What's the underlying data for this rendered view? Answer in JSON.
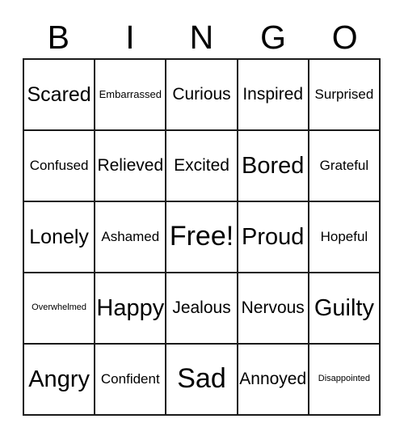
{
  "card": {
    "title": "BINGO",
    "header_letters": [
      "B",
      "I",
      "N",
      "G",
      "O"
    ],
    "border_color": "#1a1a1a",
    "text_color": "#000000",
    "background_color": "#ffffff",
    "rows": [
      [
        {
          "label": "Scared",
          "size": "t-lg"
        },
        {
          "label": "Embarrassed",
          "size": "t-xs"
        },
        {
          "label": "Curious",
          "size": "t-md"
        },
        {
          "label": "Inspired",
          "size": "t-md"
        },
        {
          "label": "Surprised",
          "size": "t-sm"
        }
      ],
      [
        {
          "label": "Confused",
          "size": "t-sm"
        },
        {
          "label": "Relieved",
          "size": "t-md"
        },
        {
          "label": "Excited",
          "size": "t-md"
        },
        {
          "label": "Bored",
          "size": "t-xl"
        },
        {
          "label": "Grateful",
          "size": "t-sm"
        }
      ],
      [
        {
          "label": "Lonely",
          "size": "t-lg"
        },
        {
          "label": "Ashamed",
          "size": "t-sm"
        },
        {
          "label": "Free!",
          "size": "t-xxl"
        },
        {
          "label": "Proud",
          "size": "t-xl"
        },
        {
          "label": "Hopeful",
          "size": "t-sm"
        }
      ],
      [
        {
          "label": "Overwhelmed",
          "size": "t-xxs"
        },
        {
          "label": "Happy",
          "size": "t-xl"
        },
        {
          "label": "Jealous",
          "size": "t-md"
        },
        {
          "label": "Nervous",
          "size": "t-md"
        },
        {
          "label": "Guilty",
          "size": "t-xl"
        }
      ],
      [
        {
          "label": "Angry",
          "size": "t-xl"
        },
        {
          "label": "Confident",
          "size": "t-sm"
        },
        {
          "label": "Sad",
          "size": "t-xxl"
        },
        {
          "label": "Annoyed",
          "size": "t-md"
        },
        {
          "label": "Disappointed",
          "size": "t-xxs"
        }
      ]
    ]
  }
}
